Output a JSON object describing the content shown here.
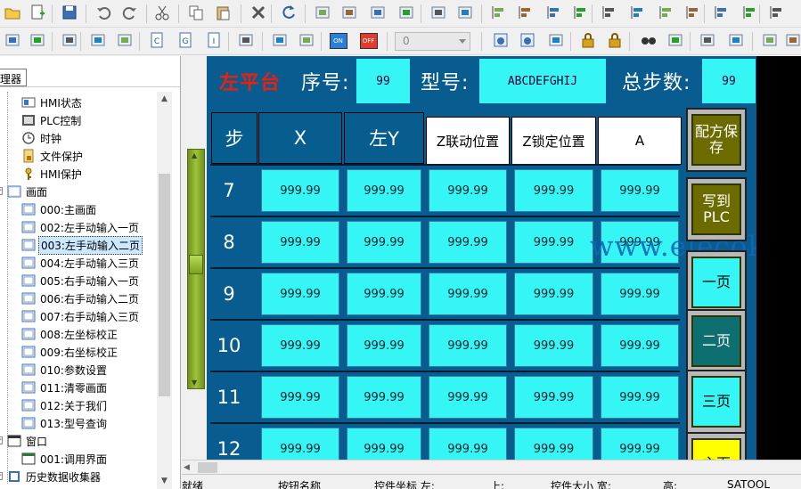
{
  "toolbar_icons_row1": [
    "open-icon",
    "new-icon",
    "save-icon",
    "undo-icon",
    "redo-icon",
    "cut-icon",
    "copy-icon",
    "paste-icon",
    "delete-icon",
    "refresh-icon",
    "bring-front-icon",
    "send-back-icon",
    "group-icon",
    "ungroup-icon",
    "fit-icon",
    "resize-icon",
    "align-left-icon",
    "align-right-icon",
    "align-top-icon",
    "align-bottom-icon",
    "align-vcenter-icon",
    "align-hcenter-icon",
    "distribute-h-icon",
    "distribute-v-icon",
    "same-width-icon",
    "same-height-icon",
    "same-size-icon"
  ],
  "toolbar_icons_row2": [
    "download-icon",
    "upload-icon",
    "import-icon",
    "export-icon",
    "import2-icon",
    "c-icon",
    "g-icon",
    "i-icon",
    "home-icon",
    "screen-add-icon",
    "screen-copy-icon",
    "on-icon",
    "off-icon",
    "back-icon",
    "forward-icon",
    "wrench-icon",
    "lock-icon",
    "unlock-icon",
    "find-icon",
    "star-icon",
    "plug-icon",
    "book-icon",
    "view1-icon",
    "view2-icon"
  ],
  "toolbar": {
    "on_label": "ON",
    "off_label": "OFF",
    "layer_select_value": "0"
  },
  "panel": {
    "tab_label": "管理器"
  },
  "tree": {
    "items": [
      {
        "label": "HMI状态",
        "icon": "hmi-status-icon",
        "level": 2
      },
      {
        "label": "PLC控制",
        "icon": "plc-control-icon",
        "level": 2
      },
      {
        "label": "时钟",
        "icon": "clock-icon",
        "level": 2
      },
      {
        "label": "文件保护",
        "icon": "file-lock-icon",
        "level": 2
      },
      {
        "label": "HMI保护",
        "icon": "key-icon",
        "level": 2
      },
      {
        "label": "画面",
        "icon": "screen-folder-icon",
        "level": 1
      },
      {
        "label": "000:主画面",
        "icon": "screen-icon",
        "level": 2
      },
      {
        "label": "002:左手动输入一页",
        "icon": "screen-icon",
        "level": 2
      },
      {
        "label": "003:左手动输入二页",
        "icon": "screen-icon",
        "level": 2,
        "selected": true
      },
      {
        "label": "004:左手动输入三页",
        "icon": "screen-icon",
        "level": 2
      },
      {
        "label": "005:右手动输入一页",
        "icon": "screen-icon",
        "level": 2
      },
      {
        "label": "006:右手动输入二页",
        "icon": "screen-icon",
        "level": 2
      },
      {
        "label": "007:右手动输入三页",
        "icon": "screen-icon",
        "level": 2
      },
      {
        "label": "008:左坐标校正",
        "icon": "screen-icon",
        "level": 2
      },
      {
        "label": "009:右坐标校正",
        "icon": "screen-icon",
        "level": 2
      },
      {
        "label": "010:参数设置",
        "icon": "screen-icon",
        "level": 2
      },
      {
        "label": "011:清零画面",
        "icon": "screen-icon",
        "level": 2
      },
      {
        "label": "012:关于我们",
        "icon": "screen-icon",
        "level": 2
      },
      {
        "label": "013:型号查询",
        "icon": "screen-icon",
        "level": 2
      },
      {
        "label": "窗口",
        "icon": "window-folder-icon",
        "level": 1
      },
      {
        "label": "001:调用界面",
        "icon": "window-icon",
        "level": 2
      },
      {
        "label": "历史数据收集器",
        "icon": "history-icon",
        "level": 1
      }
    ]
  },
  "hmi": {
    "platform_label": "左平台",
    "seq_label": "序号:",
    "seq_value": "99",
    "model_label": "型号:",
    "model_value": "ABCDEFGHIJ",
    "total_steps_label": "总步数:",
    "total_steps_value": "99",
    "columns": [
      "步",
      "X",
      "左Y",
      "Z联动位置",
      "Z锁定位置",
      "A"
    ],
    "rows": [
      {
        "step": "7",
        "values": [
          "999.99",
          "999.99",
          "999.99",
          "999.99",
          "999.99"
        ]
      },
      {
        "step": "8",
        "values": [
          "999.99",
          "999.99",
          "999.99",
          "999.99",
          "999.99"
        ]
      },
      {
        "step": "9",
        "values": [
          "999.99",
          "999.99",
          "999.99",
          "999.99",
          "999.99"
        ]
      },
      {
        "step": "10",
        "values": [
          "999.99",
          "999.99",
          "999.99",
          "999.99",
          "999.99"
        ]
      },
      {
        "step": "11",
        "values": [
          "999.99",
          "999.99",
          "999.99",
          "999.99",
          "999.99"
        ]
      },
      {
        "step": "12",
        "values": [
          "999.99",
          "999.99",
          "999.99",
          "999.99",
          "999.99"
        ]
      }
    ],
    "side_buttons": [
      {
        "label": "配方保存",
        "bg": "#6b6b00",
        "fg": "#ffffff"
      },
      {
        "label": "写到PLC",
        "bg": "#6b6b00",
        "fg": "#ffffff"
      },
      {
        "label": "一页",
        "bg": "#36f5f5",
        "fg": "#000000"
      },
      {
        "label": "二页",
        "bg": "#0d6f6f",
        "fg": "#ffffff"
      },
      {
        "label": "三页",
        "bg": "#36f5f5",
        "fg": "#000000"
      },
      {
        "label": "主页",
        "bg": "#ffff00",
        "fg": "#000000"
      }
    ],
    "watermark": "www.elecok.com"
  },
  "status": {
    "ready": "就绪",
    "button_name": "按钮名称",
    "coords_label": "控件坐标  左:",
    "top_label": "上:",
    "size_label": "控件大小  宽:",
    "height_label": "高:",
    "app": "SATOOL"
  },
  "colors": {
    "hmi_bg": "#085c8f",
    "cell_cyan": "#36f5f5",
    "platform_red": "#e8220f"
  }
}
